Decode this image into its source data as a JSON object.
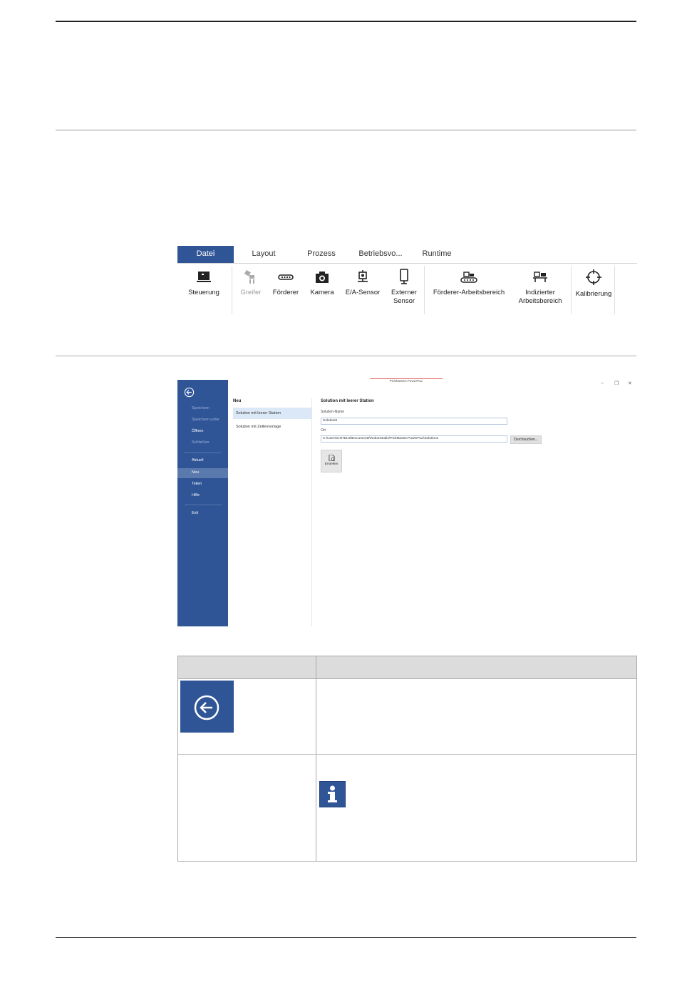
{
  "ribbon": {
    "tabs": [
      "Datei",
      "Layout",
      "Prozess",
      "Betriebsvo...",
      "Runtime"
    ],
    "buttons": {
      "steuerung": "Steuerung",
      "greifer": "Greifer",
      "foerderer": "Förderer",
      "kamera": "Kamera",
      "ea_sensor": "E/A-Sensor",
      "externer_sensor_1": "Externer",
      "externer_sensor_2": "Sensor",
      "foerderer_arbeitsbereich": "Förderer-Arbeitsbereich",
      "indizierter_1": "Indizierter",
      "indizierter_2": "Arbeitsbereich",
      "kalibrierung": "Kalibrierung"
    }
  },
  "app": {
    "title": "PickMaster.PowerPac",
    "window_controls": {
      "minimize": "–",
      "restore": "❐",
      "close": "✕"
    },
    "sidebar": {
      "items": [
        "Speichern",
        "Speichern unter",
        "Öffnen",
        "Schließen",
        "Aktuell",
        "Neu",
        "Teilen",
        "Hilfe",
        "Exit"
      ]
    },
    "middle": {
      "header": "Neu",
      "items": [
        "Solution mit leerer Station",
        "Solution mit Zellenvorlage"
      ]
    },
    "right": {
      "title": "Solution mit leerer Station",
      "name_label": "Solution-Name",
      "name_value": "Solution8",
      "location_label": "Ort",
      "location_value": "C:\\Users\\CNTELI8\\Documents\\RobotStudio\\PickMaster.PowerPac\\Solutions",
      "browse_label": "Durchsuchen...",
      "create_label": "Erstellen"
    }
  },
  "colors": {
    "accent": "#2f5597",
    "selection": "#5a79ad",
    "table_header": "#dcdcdc"
  },
  "icons": {
    "back": "back-arrow-circle-icon",
    "info": "info-icon"
  }
}
